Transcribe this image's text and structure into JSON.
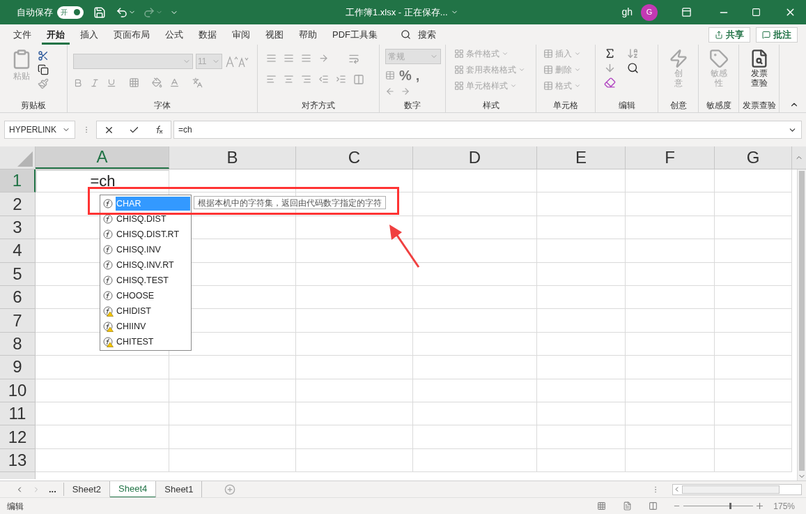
{
  "title_bar": {
    "autosave_label": "自动保存",
    "autosave_toggle": {
      "label": "开",
      "on": true
    },
    "document_title": "工作簿1.xlsx - 正在保存...",
    "user": "gh",
    "avatar_initial": "G"
  },
  "ribbon_tabs": [
    {
      "label": "文件",
      "selected": false
    },
    {
      "label": "开始",
      "selected": true
    },
    {
      "label": "插入",
      "selected": false
    },
    {
      "label": "页面布局",
      "selected": false
    },
    {
      "label": "公式",
      "selected": false
    },
    {
      "label": "数据",
      "selected": false
    },
    {
      "label": "审阅",
      "selected": false
    },
    {
      "label": "视图",
      "selected": false
    },
    {
      "label": "帮助",
      "selected": false
    },
    {
      "label": "PDF工具集",
      "selected": false
    }
  ],
  "search": {
    "label": "搜索"
  },
  "share_button": "共享",
  "comments_button": "批注",
  "ribbon": {
    "clipboard": {
      "paste": "粘贴",
      "label": "剪贴板"
    },
    "font": {
      "size": "11",
      "label": "字体"
    },
    "alignment": {
      "label": "对齐方式"
    },
    "number": {
      "format": "常规",
      "symbols": [
        "%",
        ","
      ],
      "label": "数字"
    },
    "styles": {
      "items": [
        "条件格式",
        "套用表格格式",
        "单元格样式"
      ],
      "label": "样式"
    },
    "cells": {
      "items": [
        "插入",
        "删除",
        "格式"
      ],
      "label": "单元格"
    },
    "editing": {
      "label": "编辑"
    },
    "ideas": {
      "button": "创意",
      "label": "创意"
    },
    "sensitivity": {
      "button": "敏感性",
      "label": "敏感度"
    },
    "invoice": {
      "button": "发票查验",
      "label": "发票查验"
    }
  },
  "formula_bar": {
    "name_box": "HYPERLINK",
    "formula": "=ch"
  },
  "columns": [
    {
      "label": "A",
      "selected": true
    },
    {
      "label": "B",
      "selected": false
    },
    {
      "label": "C",
      "selected": false
    },
    {
      "label": "D",
      "selected": false
    },
    {
      "label": "E",
      "selected": false
    },
    {
      "label": "F",
      "selected": false
    },
    {
      "label": "G",
      "selected": false
    }
  ],
  "rows": [
    {
      "label": "1",
      "selected": true
    },
    {
      "label": "2",
      "selected": false
    },
    {
      "label": "3",
      "selected": false
    },
    {
      "label": "4",
      "selected": false
    },
    {
      "label": "5",
      "selected": false
    },
    {
      "label": "6",
      "selected": false
    },
    {
      "label": "7",
      "selected": false
    },
    {
      "label": "8",
      "selected": false
    },
    {
      "label": "9",
      "selected": false
    },
    {
      "label": "10",
      "selected": false
    },
    {
      "label": "11",
      "selected": false
    },
    {
      "label": "12",
      "selected": false
    },
    {
      "label": "13",
      "selected": false
    }
  ],
  "cell_a1": "=ch",
  "autocomplete": {
    "items": [
      {
        "label": "CHAR",
        "selected": true,
        "kind": "function"
      },
      {
        "label": "CHISQ.DIST",
        "selected": false,
        "kind": "function"
      },
      {
        "label": "CHISQ.DIST.RT",
        "selected": false,
        "kind": "function"
      },
      {
        "label": "CHISQ.INV",
        "selected": false,
        "kind": "function"
      },
      {
        "label": "CHISQ.INV.RT",
        "selected": false,
        "kind": "function"
      },
      {
        "label": "CHISQ.TEST",
        "selected": false,
        "kind": "function"
      },
      {
        "label": "CHOOSE",
        "selected": false,
        "kind": "function"
      },
      {
        "label": "CHIDIST",
        "selected": false,
        "kind": "compat"
      },
      {
        "label": "CHIINV",
        "selected": false,
        "kind": "compat"
      },
      {
        "label": "CHITEST",
        "selected": false,
        "kind": "compat"
      }
    ],
    "tooltip": "根据本机中的字符集，返回由代码数字指定的字符"
  },
  "sheet_tabs": {
    "more": "...",
    "tabs": [
      {
        "label": "Sheet2",
        "selected": false
      },
      {
        "label": "Sheet4",
        "selected": true
      },
      {
        "label": "Sheet1",
        "selected": false
      }
    ]
  },
  "status_bar": {
    "mode": "编辑",
    "zoom_slider": {
      "level": 0.68
    },
    "zoom": "175%"
  }
}
